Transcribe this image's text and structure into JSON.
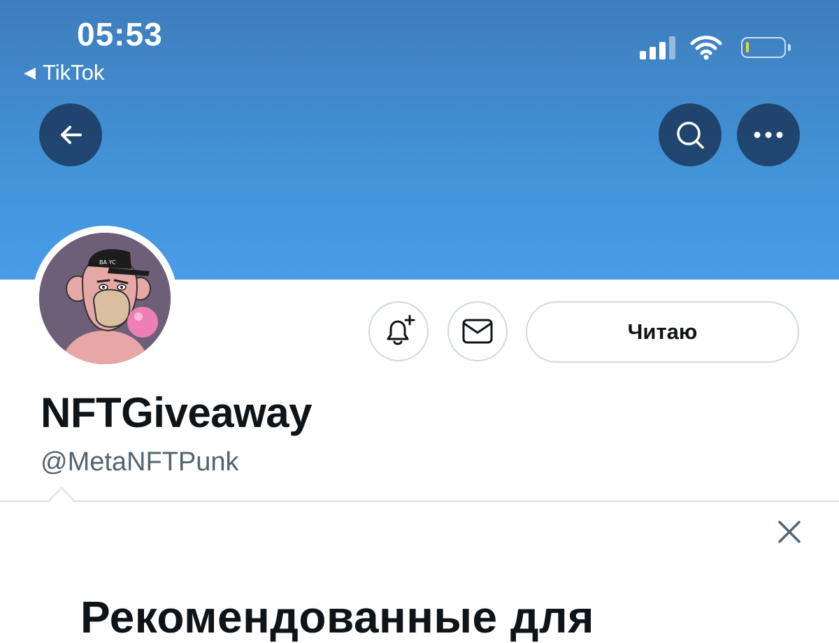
{
  "status_bar": {
    "time": "05:53",
    "back_app_label": "TikTok",
    "battery_color": "#ffd60a"
  },
  "header": {
    "banner_colors": [
      "#3e7dbc",
      "#489ce6"
    ],
    "buttons": {
      "back": "arrow-left-icon",
      "search": "search-icon",
      "more": "more-horizontal-icon"
    }
  },
  "profile": {
    "display_name": "NFTGiveaway",
    "handle": "@MetaNFTPunk",
    "avatar": "bored-ape-avatar",
    "actions": {
      "notify": "bell-plus-icon",
      "message": "envelope-icon",
      "follow_label": "Читаю"
    }
  },
  "recommendations": {
    "title": "Рекомендованные для",
    "close": "close-icon"
  }
}
